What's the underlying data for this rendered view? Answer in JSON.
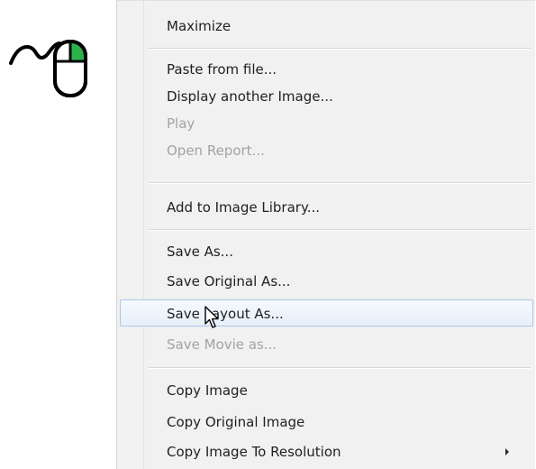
{
  "menu": {
    "items": [
      {
        "label": "Maximize",
        "state": "enabled"
      },
      {
        "label": "Paste from file...",
        "state": "enabled"
      },
      {
        "label": "Display another Image...",
        "state": "enabled"
      },
      {
        "label": "Play",
        "state": "disabled"
      },
      {
        "label": "Open Report...",
        "state": "disabled"
      },
      {
        "label": "Add to Image Library...",
        "state": "enabled"
      },
      {
        "label": "Save As...",
        "state": "enabled"
      },
      {
        "label": "Save Original As...",
        "state": "enabled"
      },
      {
        "label": "Save Layout As...",
        "state": "highlighted"
      },
      {
        "label": "Save Movie as...",
        "state": "disabled"
      },
      {
        "label": "Copy Image",
        "state": "enabled"
      },
      {
        "label": "Copy Original Image",
        "state": "enabled"
      },
      {
        "label": "Copy Image To Resolution",
        "state": "enabled",
        "submenu": true
      }
    ]
  },
  "icons": {
    "mouse": "right-click-mouse-icon",
    "cursor": "arrow-cursor-icon",
    "submenu": "submenu-arrow-icon"
  },
  "colors": {
    "menu_background": "#f1f1f1",
    "text": "#1f1f1f",
    "disabled_text": "#a3a3a3",
    "highlight_border": "#a9c6e8",
    "mouse_button_accent": "#2bb34a"
  }
}
